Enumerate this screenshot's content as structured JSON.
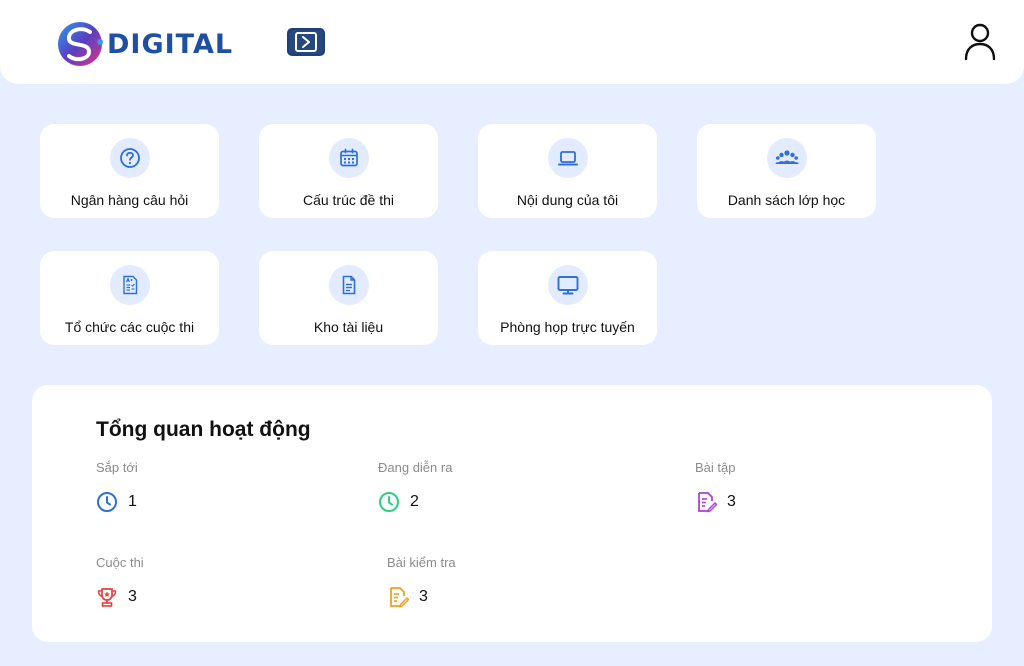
{
  "header": {
    "brand": "DIGITAL",
    "icons": {
      "logo": "digital-logo-icon",
      "sidebar_toggle": "sidebar-toggle-icon",
      "user": "user-icon"
    }
  },
  "menu": {
    "items": [
      {
        "label": "Ngân hàng câu hỏi",
        "icon": "question-circle-icon"
      },
      {
        "label": "Cấu trúc đề thi",
        "icon": "calendar-grid-icon"
      },
      {
        "label": "Nội dung của tôi",
        "icon": "laptop-icon"
      },
      {
        "label": "Danh sách lớp học",
        "icon": "group-users-icon"
      },
      {
        "label": "Tổ chức các cuộc thi",
        "icon": "graded-paper-icon"
      },
      {
        "label": "Kho tài liệu",
        "icon": "document-icon"
      },
      {
        "label": "Phòng họp trực tuyến",
        "icon": "monitor-icon"
      }
    ]
  },
  "overview": {
    "title": "Tổng quan hoạt động",
    "stats": [
      {
        "label": "Sắp tới",
        "value": "1",
        "icon": "clock-icon",
        "color": "#2f6fd6"
      },
      {
        "label": "Đang diễn ra",
        "value": "2",
        "icon": "clock-icon",
        "color": "#2ecf7f"
      },
      {
        "label": "Bài tập",
        "value": "3",
        "icon": "edit-document-icon",
        "color": "#b03fd6"
      },
      {
        "label": "Cuộc thi",
        "value": "3",
        "icon": "trophy-icon",
        "color": "#e0443e"
      },
      {
        "label": "Bài kiểm tra",
        "value": "3",
        "icon": "edit-document-icon",
        "color": "#f0a020"
      }
    ]
  },
  "colors": {
    "accent": "#2f6fd6",
    "background": "#e6eeff",
    "brand": "#1f4fa3"
  }
}
